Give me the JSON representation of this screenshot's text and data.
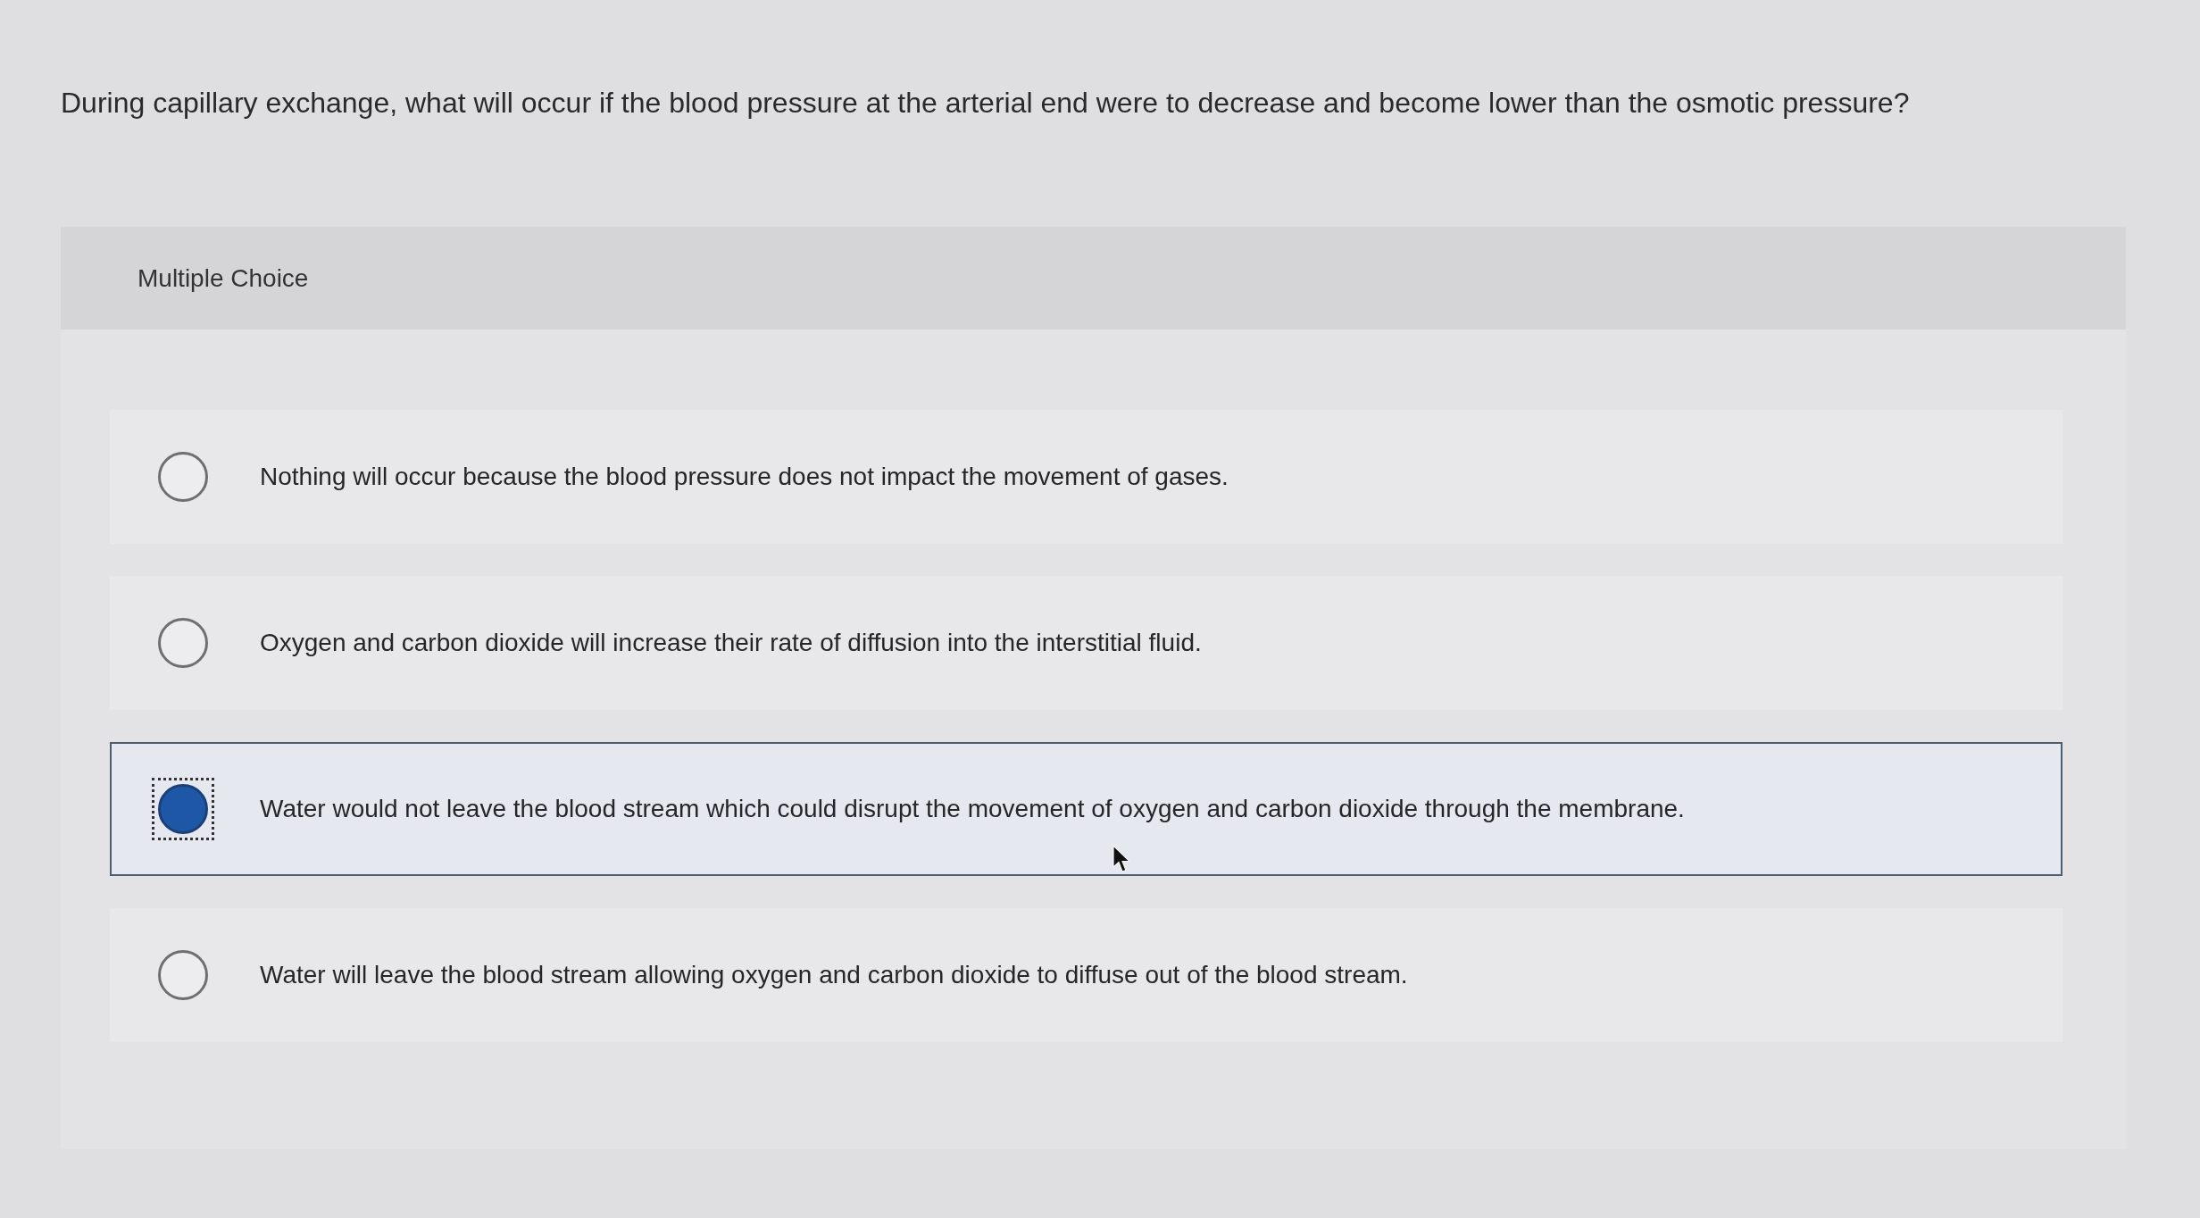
{
  "question": "During capillary exchange, what will occur if the blood pressure at the arterial end were to decrease and become lower than the osmotic pressure?",
  "panel": {
    "label": "Multiple Choice",
    "options": [
      {
        "text": "Nothing will occur because the blood pressure does not impact the movement of gases.",
        "selected": false,
        "focused": false
      },
      {
        "text": "Oxygen and carbon dioxide will increase their rate of diffusion into the interstitial fluid.",
        "selected": false,
        "focused": false
      },
      {
        "text": "Water would not leave the blood stream which could disrupt the movement of oxygen and carbon dioxide through the membrane.",
        "selected": true,
        "focused": true
      },
      {
        "text": "Water will leave the blood stream allowing oxygen and carbon dioxide to diffuse out of the blood stream.",
        "selected": false,
        "focused": false
      }
    ]
  }
}
